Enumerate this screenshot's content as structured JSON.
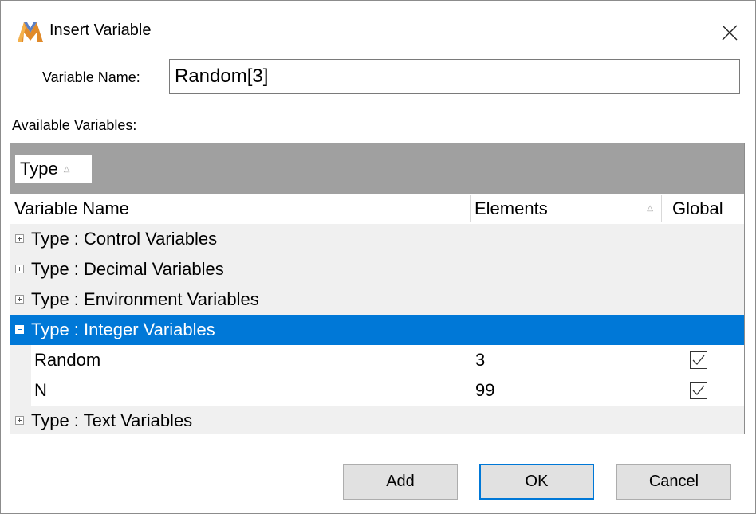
{
  "window": {
    "title": "Insert Variable"
  },
  "form": {
    "variable_name_label": "Variable Name:",
    "variable_name_value": "Random[3]"
  },
  "available_label": "Available Variables:",
  "group_panel": {
    "chip_label": "Type"
  },
  "columns": {
    "name": "Variable Name",
    "elements": "Elements",
    "global": "Global"
  },
  "groups": [
    {
      "label": "Type : Control Variables",
      "expanded": false
    },
    {
      "label": "Type : Decimal Variables",
      "expanded": false
    },
    {
      "label": "Type : Environment Variables",
      "expanded": false
    },
    {
      "label": "Type : Integer Variables",
      "expanded": true,
      "selected": true
    },
    {
      "label": "Type : Text Variables",
      "expanded": false
    }
  ],
  "integer_rows": [
    {
      "name": "Random",
      "elements": "3",
      "global": true
    },
    {
      "name": "N",
      "elements": "99",
      "global": true
    }
  ],
  "buttons": {
    "add": "Add",
    "ok": "OK",
    "cancel": "Cancel"
  },
  "colors": {
    "selection": "#0078d7",
    "group_panel_bg": "#a0a0a0",
    "row_bg": "#f0f0f0"
  }
}
